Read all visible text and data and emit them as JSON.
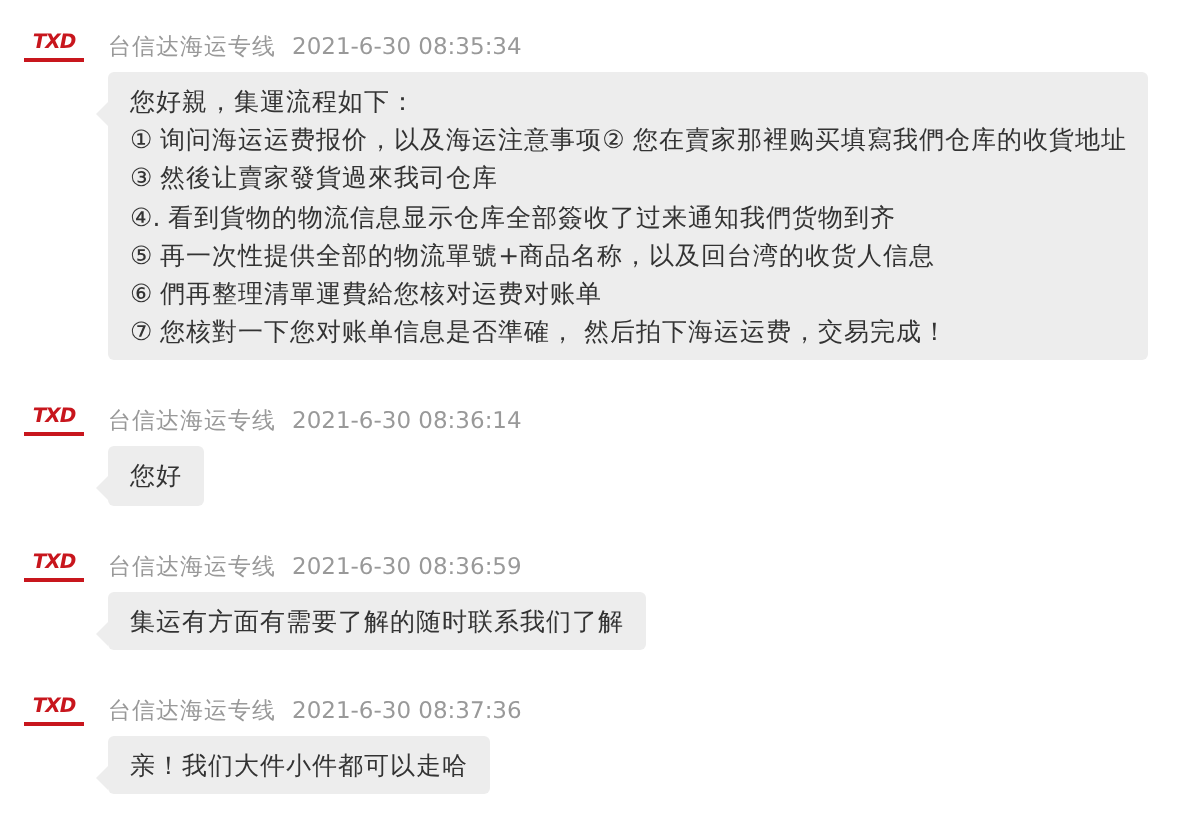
{
  "messages": [
    {
      "logo_text": "TXD",
      "sender": "台信达海运专线",
      "time": "2021-6-30 08:35:34",
      "text": "您好親，集運流程如下：\n① 询问海运运费报价，以及海运注意事项② 您在賣家那裡购买填寫我們仓库的收貨地址\n③ 然後让賣家發貨過來我司仓库\n④. 看到貨物的物流信息显示仓库全部簽收了过来通知我們货物到齐\n⑤ 再一次性提供全部的物流單號+商品名称，以及回台湾的收货人信息\n⑥ 們再整理清單運費給您核对运费对账单\n⑦ 您核對一下您对账单信息是否準確， 然后拍下海运运费，交易完成！"
    },
    {
      "logo_text": "TXD",
      "sender": "台信达海运专线",
      "time": "2021-6-30 08:36:14",
      "text": "您好"
    },
    {
      "logo_text": "TXD",
      "sender": "台信达海运专线",
      "time": "2021-6-30 08:36:59",
      "text": "集运有方面有需要了解的随时联系我们了解"
    },
    {
      "logo_text": "TXD",
      "sender": "台信达海运专线",
      "time": "2021-6-30 08:37:36",
      "text": "亲！我们大件小件都可以走哈"
    }
  ]
}
